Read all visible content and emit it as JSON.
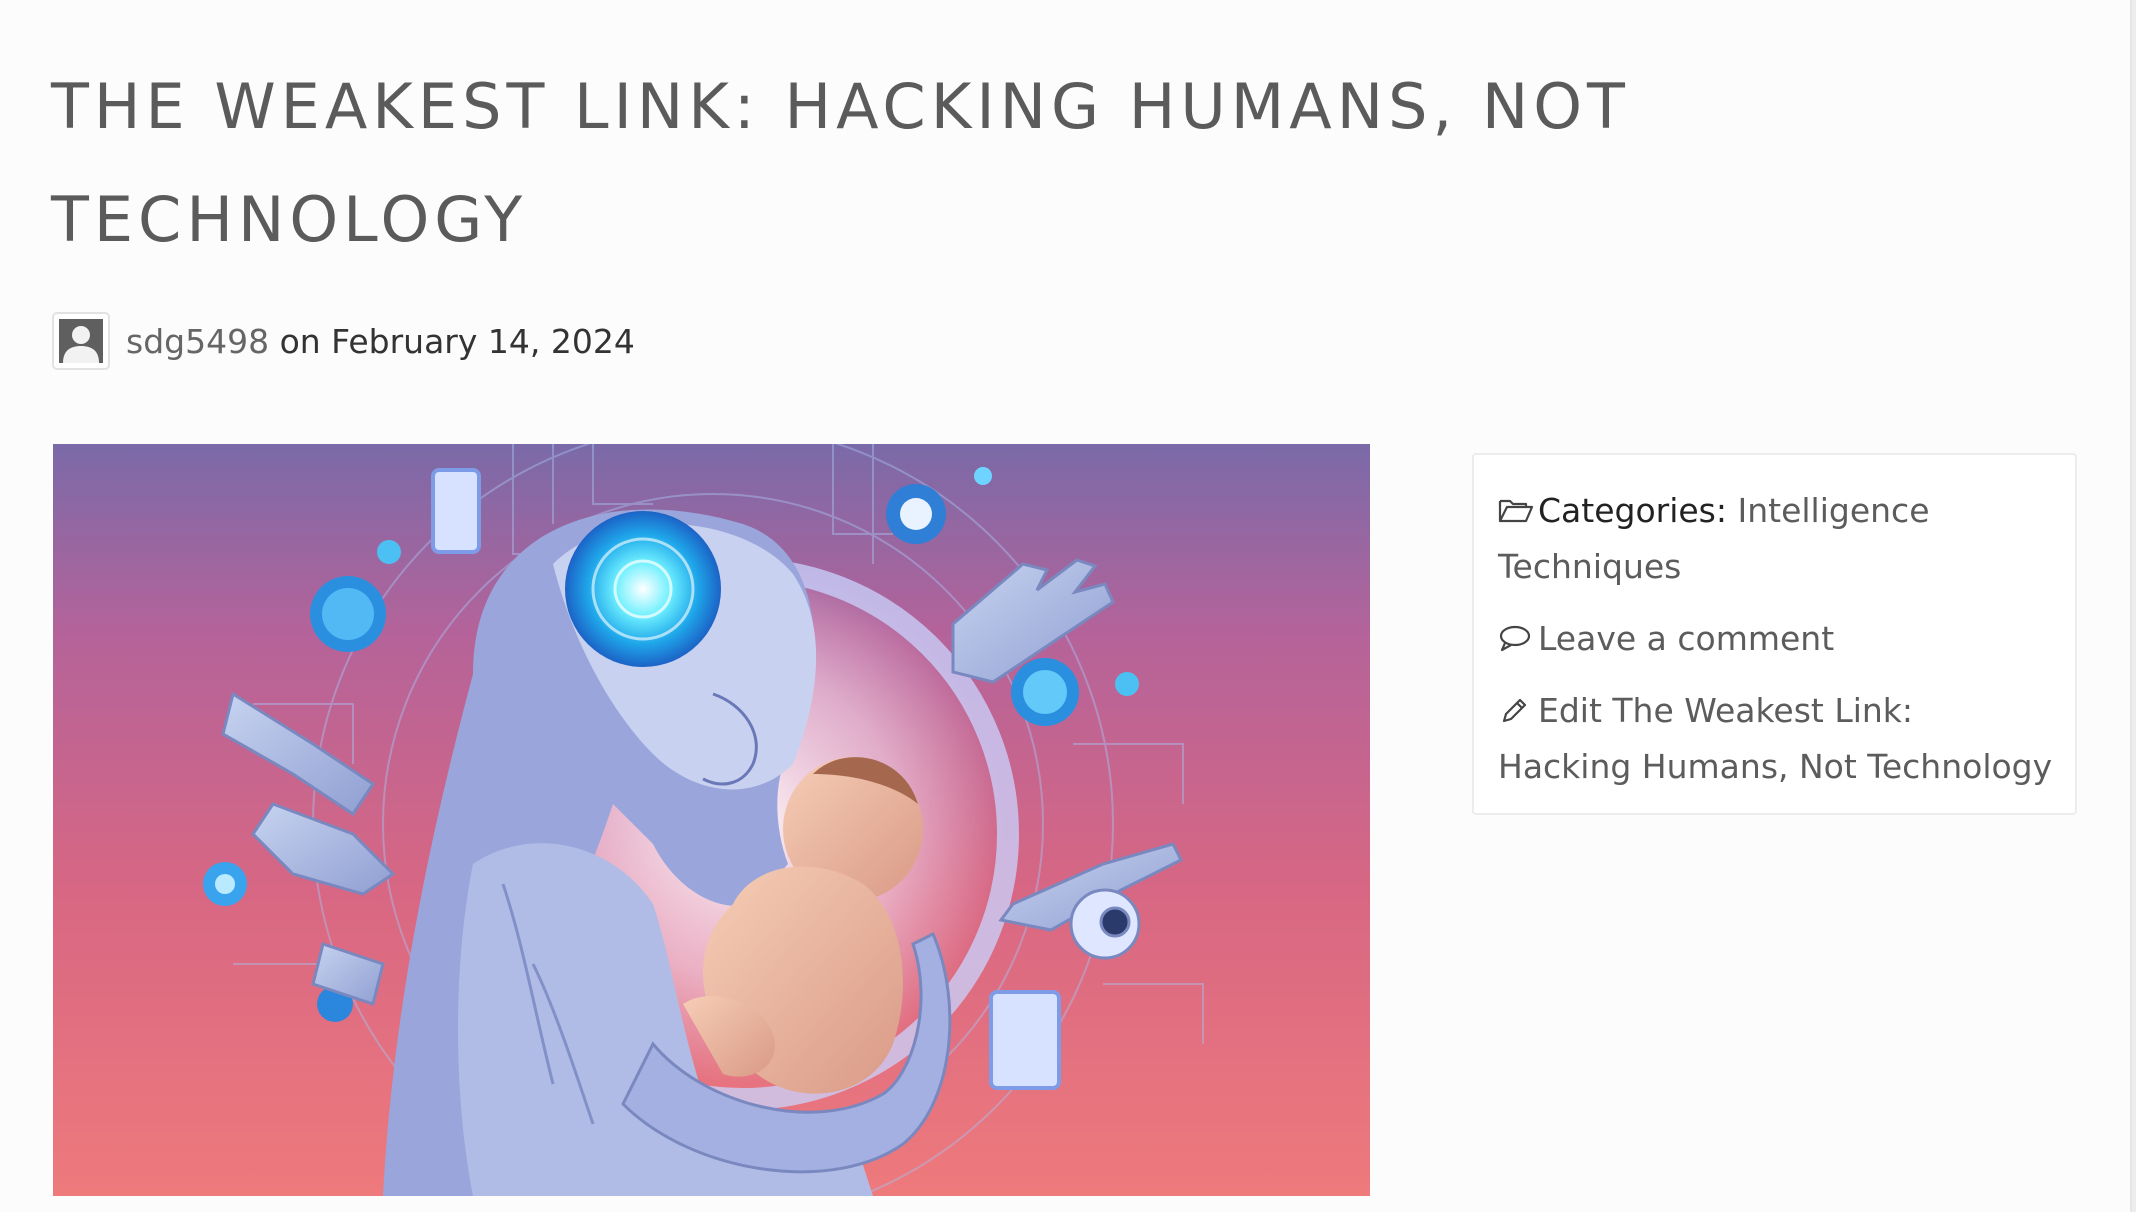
{
  "post": {
    "title": "The Weakest Link: Hacking Humans, Not Technology",
    "author": "sdg5498",
    "date_prefix": " on ",
    "date": "February 14, 2024"
  },
  "sidebar": {
    "categories_label": "Categories:",
    "category": "Intelligence Techniques",
    "comment_link": "Leave a comment",
    "edit_link": "Edit The Weakest Link: Hacking Humans, Not Technology"
  },
  "colors": {
    "title": "#5b5b5b",
    "link": "#5c5c5c",
    "page_bg": "#fcfcfc",
    "image_pink": "#e66d7f",
    "image_blue": "#3fb4f0"
  },
  "icons": {
    "categories": "folder-open-icon",
    "comment": "speech-bubble-icon",
    "edit": "pencil-icon",
    "avatar": "user-silhouette-icon"
  }
}
